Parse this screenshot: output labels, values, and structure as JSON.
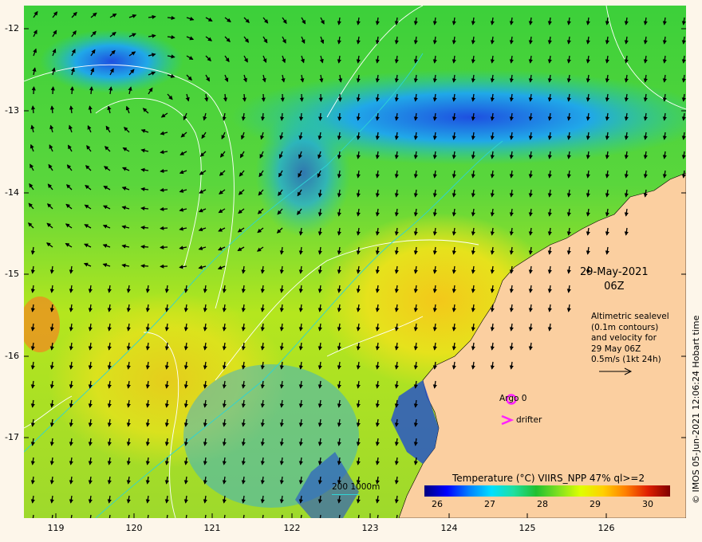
{
  "map": {
    "date_line1": "29-May-2021",
    "date_line2": "06Z",
    "description": [
      "Altimetric sealevel",
      "(0.1m contours)",
      "and velocity for",
      "29 May 06Z",
      "0.5m/s (1kt 24h)"
    ],
    "credit": "© IMOS 05-Jun-2021 12:06:24 Hobart time",
    "lat_ticks": [
      "-12",
      "-13",
      "-14",
      "-15",
      "-16",
      "-17"
    ],
    "lon_ticks": [
      "119",
      "120",
      "121",
      "122",
      "123",
      "124",
      "125",
      "126"
    ],
    "colorbar": {
      "title": "Temperature (°C) VIIRS_NPP 47% ql>=2",
      "ticks": [
        "26",
        "27",
        "28",
        "29",
        "30"
      ]
    },
    "bathy_label": "200  1000m",
    "argo_label": "Argo 0",
    "drifter_label": "drifter",
    "colors": {
      "land": "#fbcfa0",
      "arrow": "#000000",
      "argo": "#ff22ff",
      "contour": "#ffffff",
      "bathy": "#2ed4d4"
    }
  }
}
